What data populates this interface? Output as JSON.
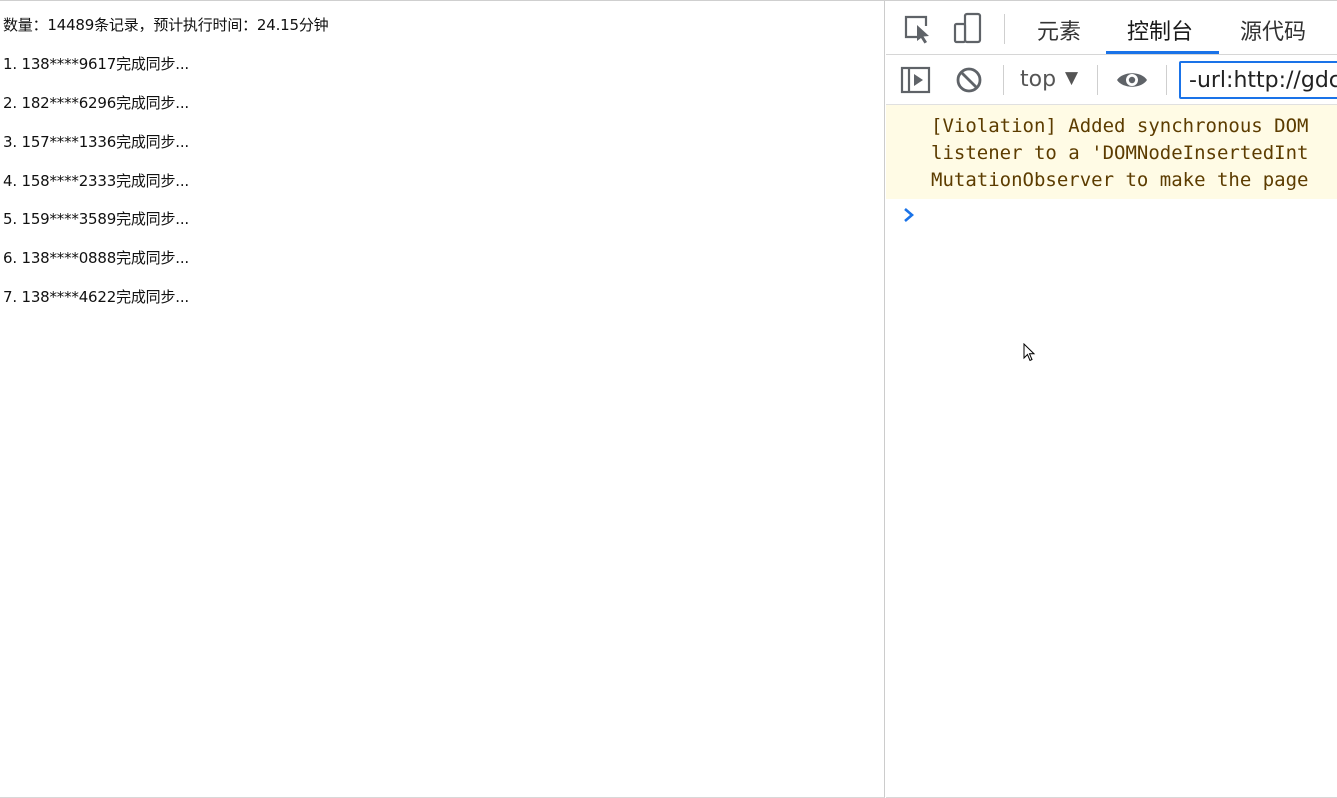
{
  "page": {
    "summary": "数量：14489条记录，预计执行时间：24.15分钟",
    "log_lines": [
      "1. 138****9617完成同步...",
      "2. 182****6296完成同步...",
      "3. 157****1336完成同步...",
      "4. 158****2333完成同步...",
      "5. 159****3589完成同步...",
      "6. 138****0888完成同步...",
      "7. 138****4622完成同步..."
    ]
  },
  "devtools": {
    "tabs": [
      "元素",
      "控制台",
      "源代码"
    ],
    "active_tab": "控制台",
    "accent_color": "#1a73e8",
    "icons": [
      "inspect-element-icon",
      "device-toolbar-icon",
      "sidebar-toggle-icon",
      "clear-console-icon",
      "live-expression-eye-icon"
    ],
    "context": "top",
    "filter_value": "-url:http://gdc.c",
    "violation_lines": [
      "[Violation] Added synchronous DOM",
      "listener to a 'DOMNodeInsertedInt",
      "MutationObserver to make the page"
    ],
    "warning_background": "#fffbe5"
  }
}
